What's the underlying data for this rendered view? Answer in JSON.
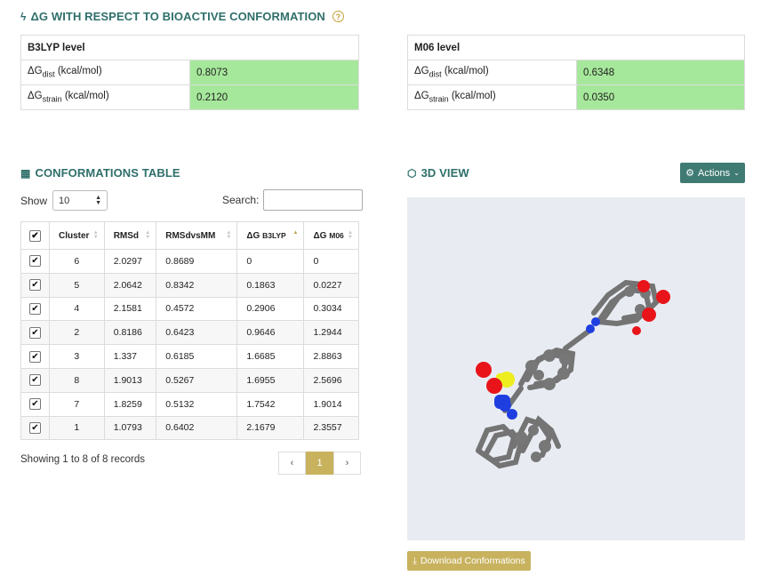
{
  "header": {
    "title": "ΔG WITH RESPECT TO BIOACTIVE CONFORMATION",
    "bolt_icon": "bolt-icon",
    "help_icon": "question-circle-icon"
  },
  "b3lyp": {
    "title": "B3LYP level",
    "rows": [
      {
        "label_main": "ΔG",
        "label_sub": "dist",
        "label_unit": " (kcal/mol)",
        "value": "0.8073"
      },
      {
        "label_main": "ΔG",
        "label_sub": "strain",
        "label_unit": " (kcal/mol)",
        "value": "0.2120"
      }
    ]
  },
  "m06": {
    "title": "M06 level",
    "rows": [
      {
        "label_main": "ΔG",
        "label_sub": "dist",
        "label_unit": " (kcal/mol)",
        "value": "0.6348"
      },
      {
        "label_main": "ΔG",
        "label_sub": "strain",
        "label_unit": " (kcal/mol)",
        "value": "0.0350"
      }
    ]
  },
  "conformations": {
    "title": "CONFORMATIONS TABLE",
    "show_label": "Show",
    "show_value": "10",
    "search_label": "Search:",
    "columns": [
      "Cluster",
      "RMSd",
      "RMSdvsMM",
      "ΔG",
      "B3LYP",
      "ΔG",
      "M06"
    ],
    "rows": [
      [
        "6",
        "2.0297",
        "0.8689",
        "0",
        "0"
      ],
      [
        "5",
        "2.0642",
        "0.8342",
        "0.1863",
        "0.0227"
      ],
      [
        "4",
        "2.1581",
        "0.4572",
        "0.2906",
        "0.3034"
      ],
      [
        "2",
        "0.8186",
        "0.6423",
        "0.9646",
        "1.2944"
      ],
      [
        "3",
        "1.337",
        "0.6185",
        "1.6685",
        "2.8863"
      ],
      [
        "8",
        "1.9013",
        "0.5267",
        "1.6955",
        "2.5696"
      ],
      [
        "7",
        "1.8259",
        "0.5132",
        "1.7542",
        "1.9014"
      ],
      [
        "1",
        "1.0793",
        "0.6402",
        "2.1679",
        "2.3557"
      ]
    ],
    "info": "Showing 1 to 8 of 8 records",
    "pager": {
      "prev": "‹",
      "page": "1",
      "next": "›"
    }
  },
  "view3d": {
    "title": "3D VIEW",
    "actions_label": "Actions",
    "download_label": "Download Conformations",
    "colors": {
      "carbon": "#6e6e6e",
      "oxygen": "#e8141a",
      "nitrogen": "#1f3ee0",
      "sulfur": "#eded1f",
      "background": "#e8ecf2"
    }
  }
}
